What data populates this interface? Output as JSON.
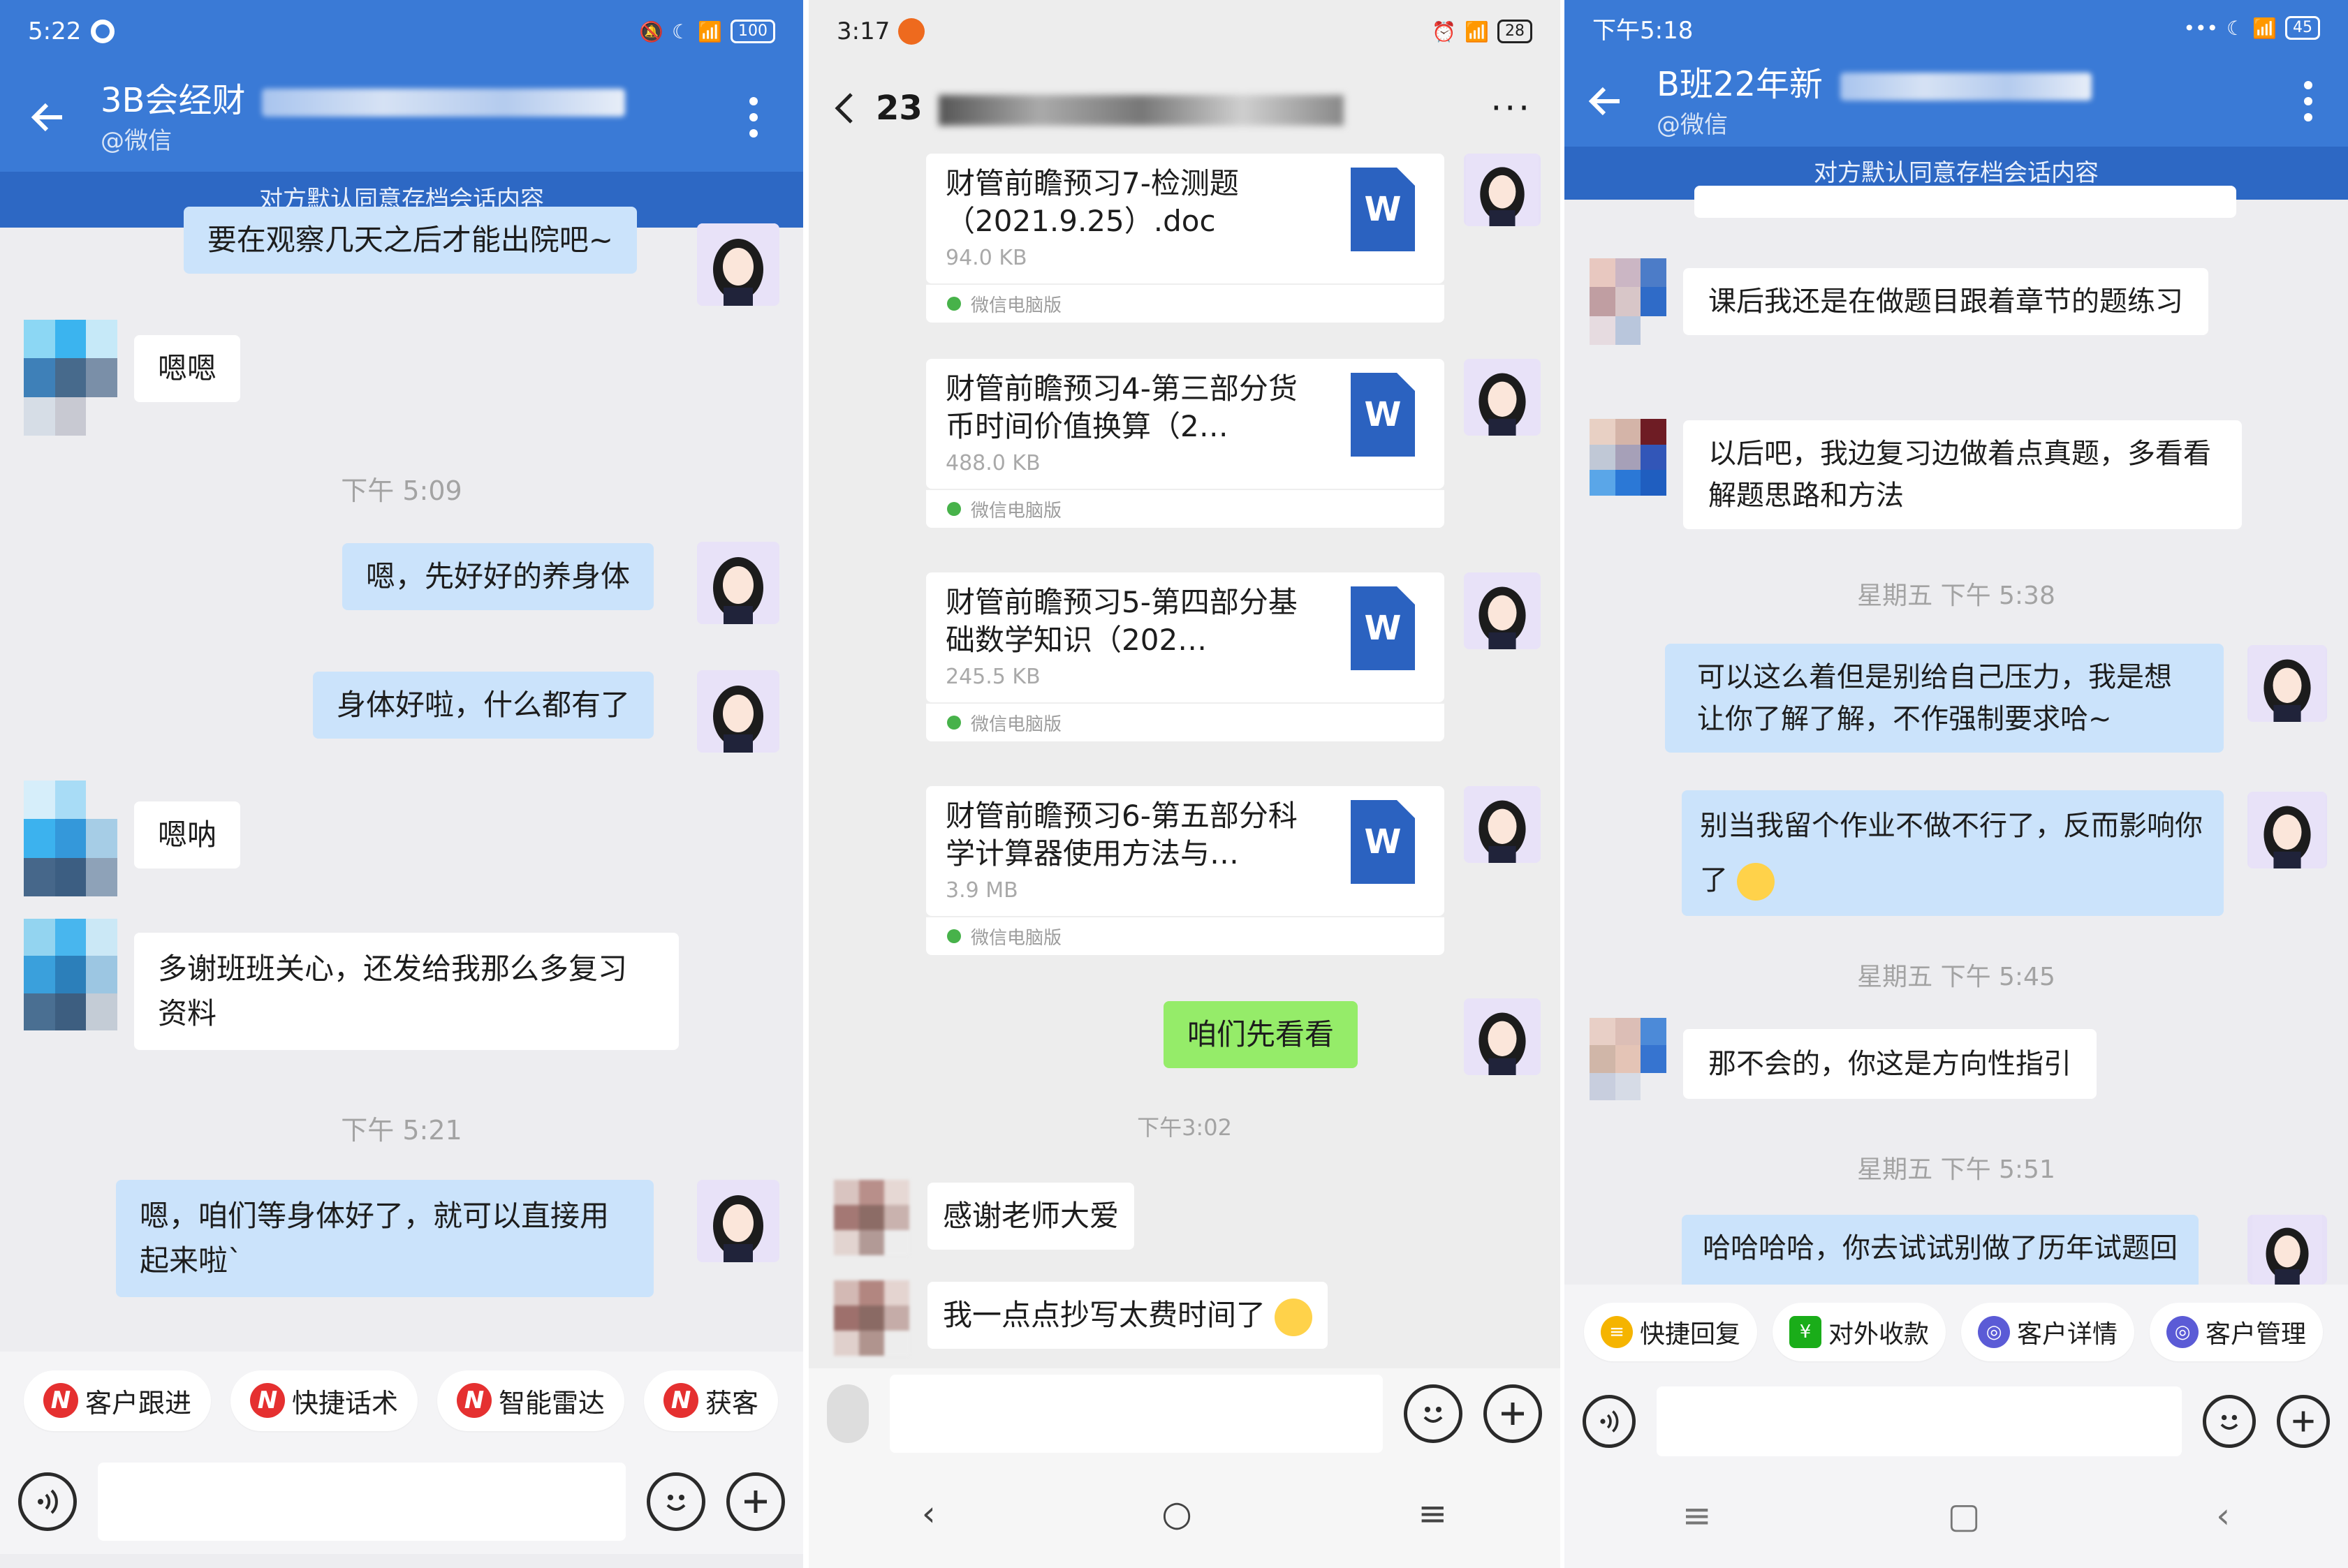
{
  "panel1": {
    "status": {
      "time": "5:22",
      "battery": "100"
    },
    "header": {
      "title": "3B会经财",
      "subtitle": "@微信",
      "more_icon": "kebab-icon"
    },
    "notice": "对方默认同意存档会话内容",
    "messages": [
      {
        "side": "out",
        "text": "要在观察几天之后才能出院吧~"
      },
      {
        "side": "in",
        "text": "嗯嗯"
      },
      {
        "side": "out",
        "text": "嗯，先好好的养身体"
      },
      {
        "side": "out",
        "text": "身体好啦，什么都有了"
      },
      {
        "side": "in",
        "text": "嗯呐"
      },
      {
        "side": "in",
        "text": "多谢班班关心，还发给我那么多复习资料"
      },
      {
        "side": "out",
        "text": "嗯，咱们等身体好了，就可以直接用起来啦`"
      }
    ],
    "timestamps": [
      "下午 5:09",
      "下午 5:21"
    ],
    "toolbar": [
      "客户跟进",
      "快捷话术",
      "智能雷达",
      "获客"
    ]
  },
  "panel2": {
    "status": {
      "time": "3:17",
      "battery": "28"
    },
    "header": {
      "title": "23"
    },
    "files": [
      {
        "title": "财管前瞻预习7-检测题（2021.9.25）.doc",
        "size": "94.0 KB",
        "source": "微信电脑版"
      },
      {
        "title": "财管前瞻预习4-第三部分货币时间价值换算（2…",
        "size": "488.0 KB",
        "source": "微信电脑版"
      },
      {
        "title": "财管前瞻预习5-第四部分基础数学知识（202…",
        "size": "245.5 KB",
        "source": "微信电脑版"
      },
      {
        "title": "财管前瞻预习6-第五部分科学计算器使用方法与…",
        "size": "3.9 MB",
        "source": "微信电脑版"
      }
    ],
    "file_icon_letter": "W",
    "out_message": "咱们先看看",
    "timestamp": "下午3:02",
    "in_messages": [
      "感谢老师大爱",
      "我一点点抄写太费时间了"
    ]
  },
  "panel3": {
    "status": {
      "time": "下午5:18",
      "battery": "45"
    },
    "header": {
      "title": "B班22年新",
      "subtitle": "@微信"
    },
    "notice": "对方默认同意存档会话内容",
    "messages": [
      {
        "side": "in",
        "text": "课后我还是在做题目跟着章节的题练习"
      },
      {
        "side": "in",
        "text": "以后吧，我边复习边做着点真题，多看看解题思路和方法"
      },
      {
        "side": "out",
        "text": "可以这么着但是别给自己压力，我是想让你了解了解，不作强制要求哈~"
      },
      {
        "side": "out",
        "text": "别当我留个作业不做不行了，反而影响你了"
      },
      {
        "side": "in",
        "text": "那不会的，你这是方向性指引"
      },
      {
        "side": "out",
        "text": "哈哈哈哈，你去试试别做了历年试题回"
      }
    ],
    "timestamps": [
      "星期五 下午 5:38",
      "星期五 下午 5:45",
      "星期五 下午 5:51"
    ],
    "toolbar": [
      "快捷回复",
      "对外收款",
      "客户详情",
      "客户管理"
    ],
    "toolbar_colors": [
      "#f5b400",
      "#1aad19",
      "#5b5bd6",
      "#5b5bd6"
    ]
  },
  "colors": {
    "header_blue": "#3a7ad6",
    "notice_blue": "#2d68c4",
    "out_bubble": "#cbe3fb",
    "green_bubble": "#95ec69",
    "word_blue": "#2b62c0"
  }
}
